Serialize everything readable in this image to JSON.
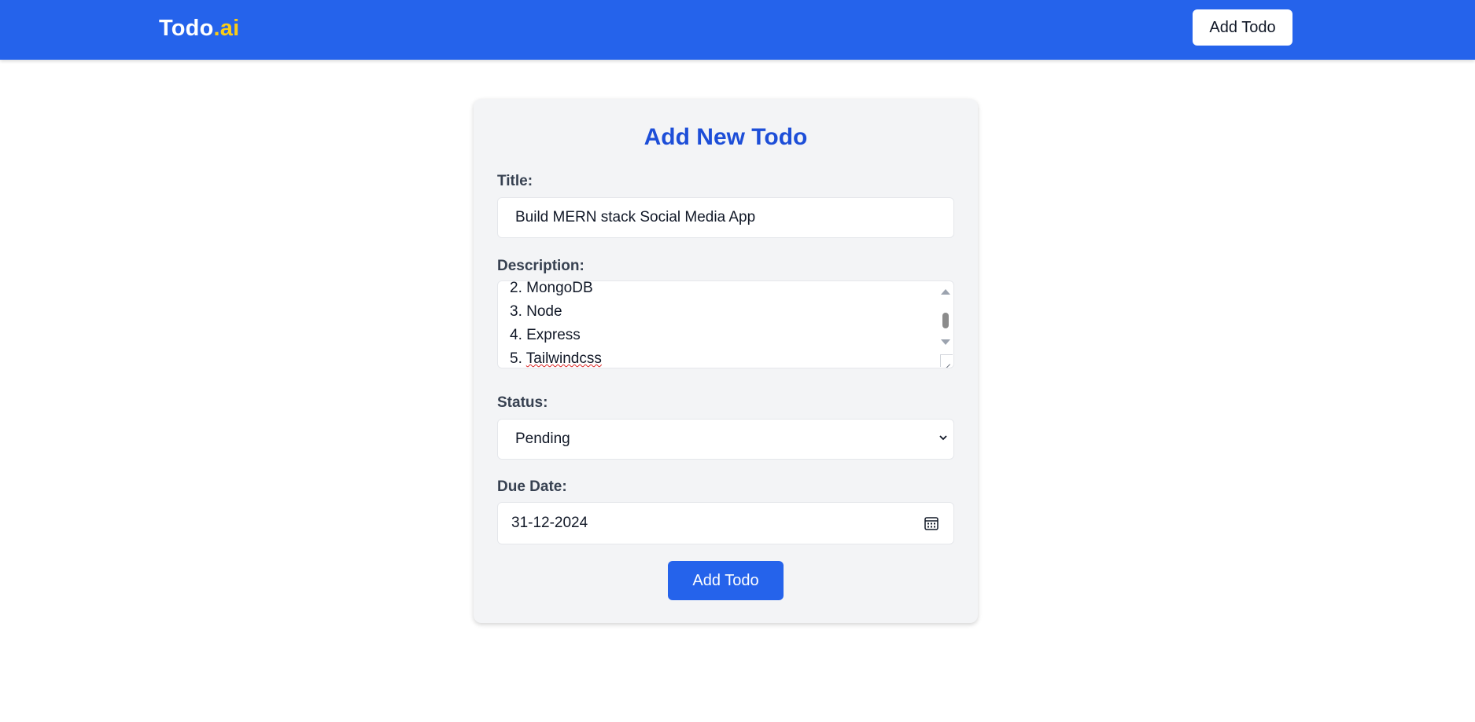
{
  "navbar": {
    "logo_main": "Todo",
    "logo_accent": ".ai",
    "add_button": "Add Todo"
  },
  "form": {
    "title": "Add New Todo",
    "title_label": "Title:",
    "title_value": "Build MERN stack Social Media App",
    "description_label": "Description:",
    "description_lines": [
      "2. MongoDB",
      "3. Node",
      "4. Express",
      "5. Tailwindcss"
    ],
    "status_label": "Status:",
    "status_value": "Pending",
    "due_date_label": "Due Date:",
    "due_date_value": "31-12-2024",
    "submit_button": "Add Todo"
  },
  "colors": {
    "brand": "#2563eb",
    "accent": "#facc15",
    "heading": "#1d4ed8"
  }
}
